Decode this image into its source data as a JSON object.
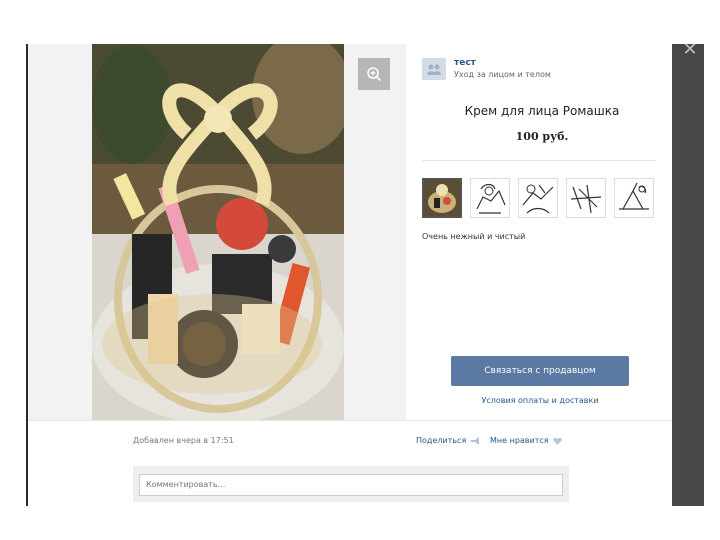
{
  "seller": {
    "name": "тест",
    "category": "Уход за лицом и телом"
  },
  "product": {
    "title": "Крем для лица Ромашка",
    "price": "100 руб.",
    "description": "Очень нежный и чистый"
  },
  "buttons": {
    "contact": "Связаться с продавцом",
    "terms": "Условия оплаты и доставки"
  },
  "footer": {
    "added": "Добавлен вчера в 17:51",
    "share": "Поделиться",
    "like": "Мне нравится"
  },
  "comment": {
    "placeholder": "Комментировать..."
  },
  "icons": {
    "close": "close-icon",
    "zoom": "zoom-icon",
    "avatar": "group-avatar-icon",
    "share": "megaphone-icon",
    "like": "heart-icon"
  },
  "colors": {
    "link": "#2a5885",
    "button": "#5b7aa3",
    "overlay": "#474747"
  }
}
